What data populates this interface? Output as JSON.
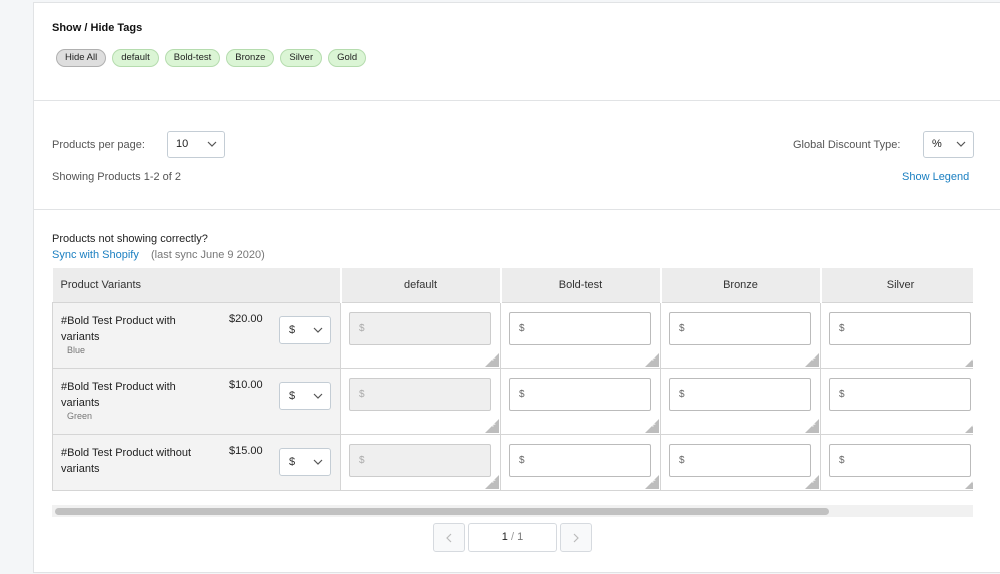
{
  "tags_section": {
    "title": "Show / Hide Tags",
    "tags": [
      "Hide All",
      "default",
      "Bold-test",
      "Bronze",
      "Silver",
      "Gold"
    ]
  },
  "settings": {
    "per_page_label": "Products per page:",
    "per_page_value": "10",
    "showing_text": "Showing Products 1-2 of 2",
    "discount_label": "Global Discount Type:",
    "discount_value": "%",
    "show_legend": "Show Legend"
  },
  "sync": {
    "notice": "Products not showing correctly?",
    "link": "Sync with Shopify",
    "last_sync": "(last sync June 9 2020)"
  },
  "table": {
    "headers": [
      "Product Variants",
      "default",
      "Bold-test",
      "Bronze",
      "Silver"
    ],
    "currency_placeholder": "$",
    "rows": [
      {
        "name": "#Bold Test Product with variants",
        "variant": "Blue",
        "price": "$20.00",
        "currency": "$"
      },
      {
        "name": "#Bold Test Product with variants",
        "variant": "Green",
        "price": "$10.00",
        "currency": "$"
      },
      {
        "name": "#Bold Test Product without variants",
        "variant": "",
        "price": "$15.00",
        "currency": "$"
      }
    ]
  },
  "pagination": {
    "page": "1",
    "total": "1"
  }
}
